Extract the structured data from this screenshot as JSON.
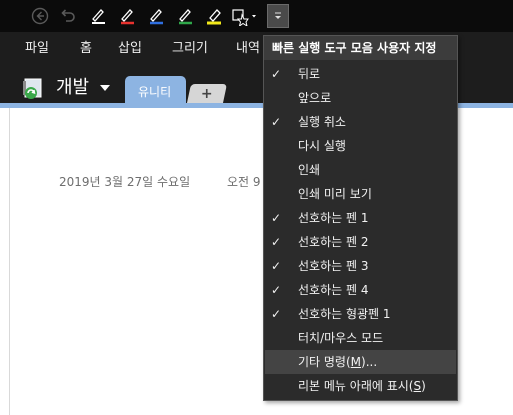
{
  "ribbon": {
    "tabs": [
      {
        "label": "파일"
      },
      {
        "label": "홈"
      },
      {
        "label": "삽입"
      },
      {
        "label": "그리기"
      },
      {
        "label": "내역"
      }
    ]
  },
  "notebook": {
    "name": "개발",
    "section_tab": "유니티",
    "add_tab": "+"
  },
  "page": {
    "date": "2019년 3월 27일 수요일",
    "time": "오전 9"
  },
  "menu": {
    "header": "빠른 실행 도구 모음 사용자 지정",
    "items": [
      {
        "label": "뒤로",
        "checked": true
      },
      {
        "label": "앞으로",
        "checked": false
      },
      {
        "label": "실행 취소",
        "checked": true
      },
      {
        "label": "다시 실행",
        "checked": false
      },
      {
        "label": "인쇄",
        "checked": false
      },
      {
        "label": "인쇄 미리 보기",
        "checked": false
      },
      {
        "label": "선호하는 펜 1",
        "checked": true
      },
      {
        "label": "선호하는 펜 2",
        "checked": true
      },
      {
        "label": "선호하는 펜 3",
        "checked": true
      },
      {
        "label": "선호하는 펜 4",
        "checked": true
      },
      {
        "label": "선호하는 형광펜 1",
        "checked": true
      },
      {
        "label": "터치/마우스 모드",
        "checked": false
      },
      {
        "label_prefix": "기타 명령(",
        "label_key": "M",
        "label_suffix": ")...",
        "checked": false,
        "highlighted": true
      },
      {
        "label_prefix": "리본 메뉴 아래에 표시(",
        "label_key": "S",
        "label_suffix": ")",
        "checked": false
      }
    ],
    "check_glyph": "✓"
  },
  "toolbar_icons": {
    "back": "back-circle-icon",
    "undo": "undo-icon",
    "pens": [
      "pen-white-icon",
      "pen-red-icon",
      "pen-blue-icon",
      "pen-green-icon",
      "highlighter-yellow-icon"
    ],
    "touch": "touch-mode-icon",
    "customize": "customize-dropdown-icon"
  },
  "colors": {
    "accent": "#8db4e2",
    "pen_red": "#e8322e",
    "pen_blue": "#2f6fe0",
    "pen_green": "#2fa84a",
    "highlighter_yellow": "#f2e81a"
  }
}
